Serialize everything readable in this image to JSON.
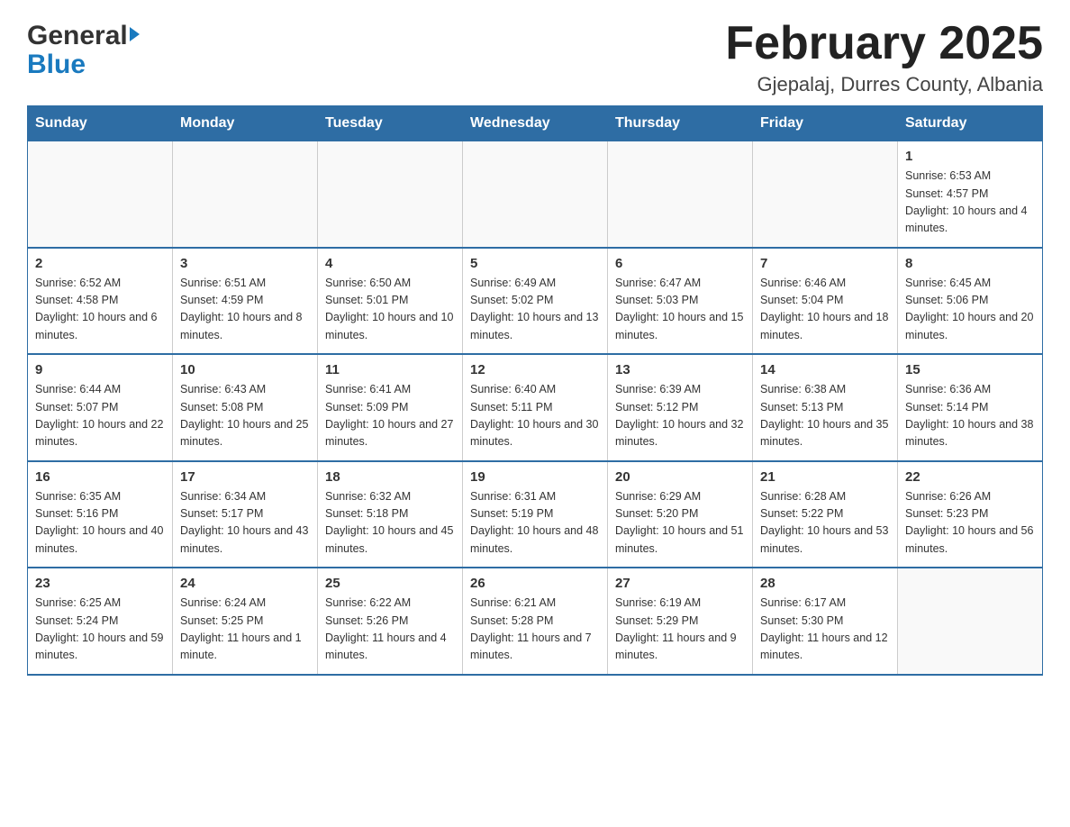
{
  "header": {
    "logo_general": "General",
    "logo_blue": "Blue",
    "title": "February 2025",
    "subtitle": "Gjepalaj, Durres County, Albania"
  },
  "calendar": {
    "days_of_week": [
      "Sunday",
      "Monday",
      "Tuesday",
      "Wednesday",
      "Thursday",
      "Friday",
      "Saturday"
    ],
    "weeks": [
      [
        {
          "day": "",
          "info": ""
        },
        {
          "day": "",
          "info": ""
        },
        {
          "day": "",
          "info": ""
        },
        {
          "day": "",
          "info": ""
        },
        {
          "day": "",
          "info": ""
        },
        {
          "day": "",
          "info": ""
        },
        {
          "day": "1",
          "info": "Sunrise: 6:53 AM\nSunset: 4:57 PM\nDaylight: 10 hours and 4 minutes."
        }
      ],
      [
        {
          "day": "2",
          "info": "Sunrise: 6:52 AM\nSunset: 4:58 PM\nDaylight: 10 hours and 6 minutes."
        },
        {
          "day": "3",
          "info": "Sunrise: 6:51 AM\nSunset: 4:59 PM\nDaylight: 10 hours and 8 minutes."
        },
        {
          "day": "4",
          "info": "Sunrise: 6:50 AM\nSunset: 5:01 PM\nDaylight: 10 hours and 10 minutes."
        },
        {
          "day": "5",
          "info": "Sunrise: 6:49 AM\nSunset: 5:02 PM\nDaylight: 10 hours and 13 minutes."
        },
        {
          "day": "6",
          "info": "Sunrise: 6:47 AM\nSunset: 5:03 PM\nDaylight: 10 hours and 15 minutes."
        },
        {
          "day": "7",
          "info": "Sunrise: 6:46 AM\nSunset: 5:04 PM\nDaylight: 10 hours and 18 minutes."
        },
        {
          "day": "8",
          "info": "Sunrise: 6:45 AM\nSunset: 5:06 PM\nDaylight: 10 hours and 20 minutes."
        }
      ],
      [
        {
          "day": "9",
          "info": "Sunrise: 6:44 AM\nSunset: 5:07 PM\nDaylight: 10 hours and 22 minutes."
        },
        {
          "day": "10",
          "info": "Sunrise: 6:43 AM\nSunset: 5:08 PM\nDaylight: 10 hours and 25 minutes."
        },
        {
          "day": "11",
          "info": "Sunrise: 6:41 AM\nSunset: 5:09 PM\nDaylight: 10 hours and 27 minutes."
        },
        {
          "day": "12",
          "info": "Sunrise: 6:40 AM\nSunset: 5:11 PM\nDaylight: 10 hours and 30 minutes."
        },
        {
          "day": "13",
          "info": "Sunrise: 6:39 AM\nSunset: 5:12 PM\nDaylight: 10 hours and 32 minutes."
        },
        {
          "day": "14",
          "info": "Sunrise: 6:38 AM\nSunset: 5:13 PM\nDaylight: 10 hours and 35 minutes."
        },
        {
          "day": "15",
          "info": "Sunrise: 6:36 AM\nSunset: 5:14 PM\nDaylight: 10 hours and 38 minutes."
        }
      ],
      [
        {
          "day": "16",
          "info": "Sunrise: 6:35 AM\nSunset: 5:16 PM\nDaylight: 10 hours and 40 minutes."
        },
        {
          "day": "17",
          "info": "Sunrise: 6:34 AM\nSunset: 5:17 PM\nDaylight: 10 hours and 43 minutes."
        },
        {
          "day": "18",
          "info": "Sunrise: 6:32 AM\nSunset: 5:18 PM\nDaylight: 10 hours and 45 minutes."
        },
        {
          "day": "19",
          "info": "Sunrise: 6:31 AM\nSunset: 5:19 PM\nDaylight: 10 hours and 48 minutes."
        },
        {
          "day": "20",
          "info": "Sunrise: 6:29 AM\nSunset: 5:20 PM\nDaylight: 10 hours and 51 minutes."
        },
        {
          "day": "21",
          "info": "Sunrise: 6:28 AM\nSunset: 5:22 PM\nDaylight: 10 hours and 53 minutes."
        },
        {
          "day": "22",
          "info": "Sunrise: 6:26 AM\nSunset: 5:23 PM\nDaylight: 10 hours and 56 minutes."
        }
      ],
      [
        {
          "day": "23",
          "info": "Sunrise: 6:25 AM\nSunset: 5:24 PM\nDaylight: 10 hours and 59 minutes."
        },
        {
          "day": "24",
          "info": "Sunrise: 6:24 AM\nSunset: 5:25 PM\nDaylight: 11 hours and 1 minute."
        },
        {
          "day": "25",
          "info": "Sunrise: 6:22 AM\nSunset: 5:26 PM\nDaylight: 11 hours and 4 minutes."
        },
        {
          "day": "26",
          "info": "Sunrise: 6:21 AM\nSunset: 5:28 PM\nDaylight: 11 hours and 7 minutes."
        },
        {
          "day": "27",
          "info": "Sunrise: 6:19 AM\nSunset: 5:29 PM\nDaylight: 11 hours and 9 minutes."
        },
        {
          "day": "28",
          "info": "Sunrise: 6:17 AM\nSunset: 5:30 PM\nDaylight: 11 hours and 12 minutes."
        },
        {
          "day": "",
          "info": ""
        }
      ]
    ]
  }
}
